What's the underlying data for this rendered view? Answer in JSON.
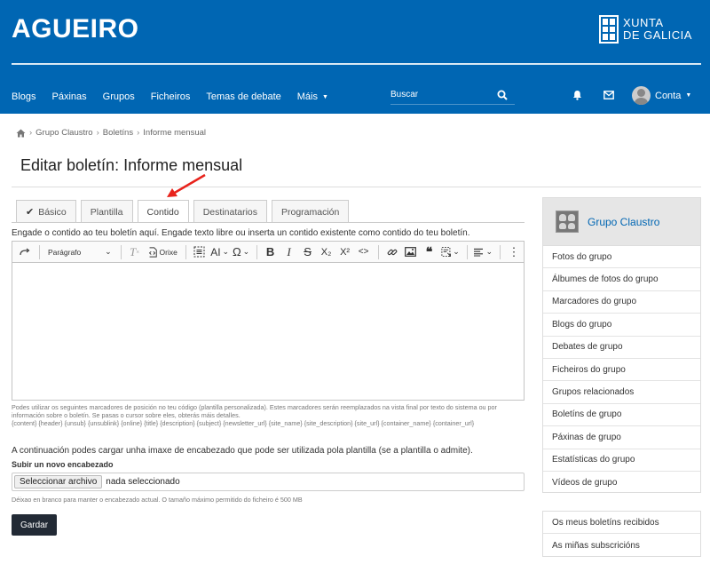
{
  "site": {
    "title": "AGUEIRO",
    "logo_line1": "XUNTA",
    "logo_line2": "DE GALICIA"
  },
  "nav": {
    "items": [
      "Blogs",
      "Páxinas",
      "Grupos",
      "Ficheiros",
      "Temas de debate"
    ],
    "more_label": "Máis",
    "search_placeholder": "Buscar",
    "user_label": "Conta"
  },
  "breadcrumb": [
    "Grupo Claustro",
    "Boletíns",
    "Informe mensual"
  ],
  "page_title": "Editar boletín: Informe mensual",
  "tabs": [
    {
      "label": "Básico",
      "icon": "check-icon"
    },
    {
      "label": "Plantilla"
    },
    {
      "label": "Contido",
      "active": true
    },
    {
      "label": "Destinatarios"
    },
    {
      "label": "Programación"
    }
  ],
  "intro": "Engade o contido ao teu boletín aquí. Engade texto libre ou inserta un contido existente como contido do teu boletín.",
  "toolbar": {
    "paragraph_label": "Parágrafo",
    "source_label": "Orixe",
    "clear_format": "T",
    "font_size": "AI",
    "special_chars": "Ω",
    "bold": "B",
    "italic": "I",
    "strike": "S",
    "subscript": "X₂",
    "superscript": "X²",
    "code": "<>",
    "quote": "❝",
    "more": "⋮"
  },
  "help_text": "Podes utilizar os seguintes marcadores de posición no teu código (plantilla personalizada). Estes marcadores serán reemplazados na vista final por texto do sistema ou por información sobre o boletín. Se pasas o cursor sobre eles, obterás máis detalles.",
  "placeholders": [
    "{content}",
    "{header}",
    "{unsub}",
    "{unsublink}",
    "{online}",
    "{title}",
    "{description}",
    "{subject}",
    "{newsletter_url}",
    "{site_name}",
    "{site_description}",
    "{site_url}",
    "{container_name}",
    "{container_url}"
  ],
  "upload": {
    "intro": "A continuación podes cargar unha imaxe de encabezado que pode ser utilizada pola plantilla (se a plantilla o admite).",
    "label": "Subir un novo encabezado",
    "button": "Seleccionar archivo",
    "status": "nada seleccionado",
    "help": "Déixao en branco para manter o encabezado actual. O tamaño máximo permitido do ficheiro é 500 MB"
  },
  "save_label": "Gardar",
  "sidebar": {
    "group_name": "Grupo Claustro",
    "items": [
      "Fotos do grupo",
      "Álbumes de fotos do grupo",
      "Marcadores do grupo",
      "Blogs do grupo",
      "Debates de grupo",
      "Ficheiros do grupo",
      "Grupos relacionados",
      "Boletíns de grupo",
      "Páxinas de grupo",
      "Estatísticas do grupo",
      "Vídeos de grupo"
    ],
    "news_items": [
      "Os meus boletíns recibidos",
      "As miñas subscricións"
    ]
  },
  "colors": {
    "header": "#0066b3",
    "link": "#0066b3",
    "button": "#222a35",
    "annotation": "#e8231c"
  }
}
